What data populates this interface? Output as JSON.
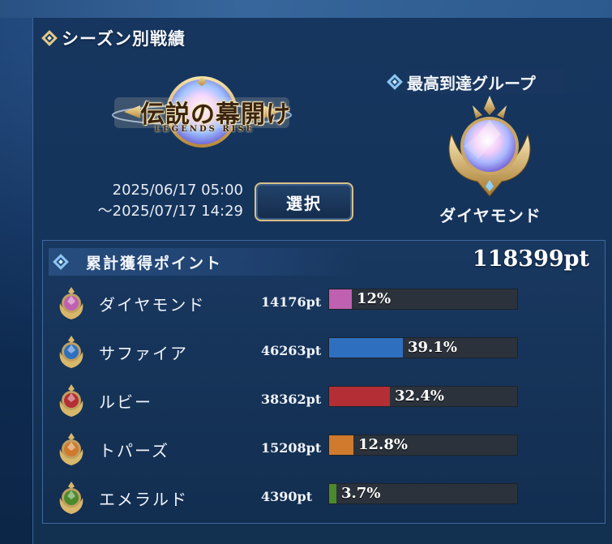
{
  "section_title": "シーズン別戦績",
  "event": {
    "logo_title": "伝説の幕開け",
    "logo_subtitle": "LEGENDS RISE",
    "date_start": "2025/06/17 05:00",
    "date_end": "～2025/07/17 14:29"
  },
  "select_button_label": "選択",
  "highest_group": {
    "title": "最高到達グループ",
    "name": "ダイヤモンド"
  },
  "points": {
    "title": "累計獲得ポイント",
    "total": "118399pt",
    "rows": [
      {
        "name": "ダイヤモンド",
        "pts": "14176pt",
        "pct_label": "12%",
        "pct": 12.0,
        "color": "#c060b0",
        "icon": "diamond-rank-icon"
      },
      {
        "name": "サファイア",
        "pts": "46263pt",
        "pct_label": "39.1%",
        "pct": 39.1,
        "color": "#2f6fc0",
        "icon": "sapphire-rank-icon"
      },
      {
        "name": "ルビー",
        "pts": "38362pt",
        "pct_label": "32.4%",
        "pct": 32.4,
        "color": "#b42e36",
        "icon": "ruby-rank-icon"
      },
      {
        "name": "トパーズ",
        "pts": "15208pt",
        "pct_label": "12.8%",
        "pct": 12.8,
        "color": "#d07a2e",
        "icon": "topaz-rank-icon"
      },
      {
        "name": "エメラルド",
        "pts": "4390pt",
        "pct_label": "3.7%",
        "pct": 3.7,
        "color": "#4a8a2c",
        "icon": "emerald-rank-icon"
      }
    ]
  }
}
